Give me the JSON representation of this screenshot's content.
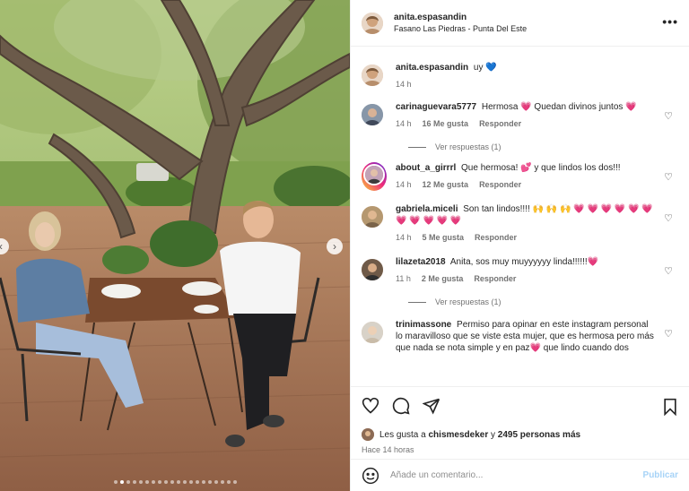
{
  "post": {
    "author": "anita.espasandin",
    "location": "Fasano Las Piedras - Punta Del Este"
  },
  "caption": {
    "user": "anita.espasandin",
    "text": "uy",
    "emoji": "💙",
    "time": "14 h"
  },
  "comments": [
    {
      "user": "carinaguevara5777",
      "text": "Hermosa 💗 Quedan divinos juntos 💗",
      "time": "14 h",
      "likes": "16 Me gusta",
      "reply": "Responder",
      "view_replies": "Ver respuestas (1)"
    },
    {
      "user": "about_a_girrrl",
      "text": "Que hermosa! 💕 y que lindos los dos!!!",
      "time": "14 h",
      "likes": "12 Me gusta",
      "reply": "Responder"
    },
    {
      "user": "gabriela.miceli",
      "text": "Son tan lindos!!!! 🙌 🙌 🙌 💗 💗 💗 💗 💗 💗 💗 💗 💗 💗 💗",
      "time": "14 h",
      "likes": "5 Me gusta",
      "reply": "Responder"
    },
    {
      "user": "lilazeta2018",
      "text": "Anita, sos muy muyyyyyy linda!!!!!!💗",
      "time": "11 h",
      "likes": "2 Me gusta",
      "reply": "Responder",
      "view_replies": "Ver respuestas (1)"
    },
    {
      "user": "trinimassone",
      "text": "Permiso para opinar en este instagram personal lo maravilloso que se viste esta mujer, que es hermosa pero más que nada se nota simple y en paz💗 que lindo cuando dos"
    }
  ],
  "likes_summary": {
    "prefix": "Les gusta a",
    "user": "chismesdeker",
    "connector": "y",
    "others": "2495 personas más"
  },
  "posted_ago": "Hace 14 horas",
  "add_comment": {
    "placeholder": "Añade un comentario...",
    "publish_label": "Publicar"
  },
  "icons": {
    "more": "more-options-icon",
    "heart": "heart-icon",
    "comment": "comment-icon",
    "share": "share-icon",
    "bookmark": "bookmark-icon",
    "emoji": "emoji-icon"
  },
  "colors": {
    "publish": "#a7d3f7",
    "secondary_text": "#737373",
    "primary_text": "#262626"
  }
}
